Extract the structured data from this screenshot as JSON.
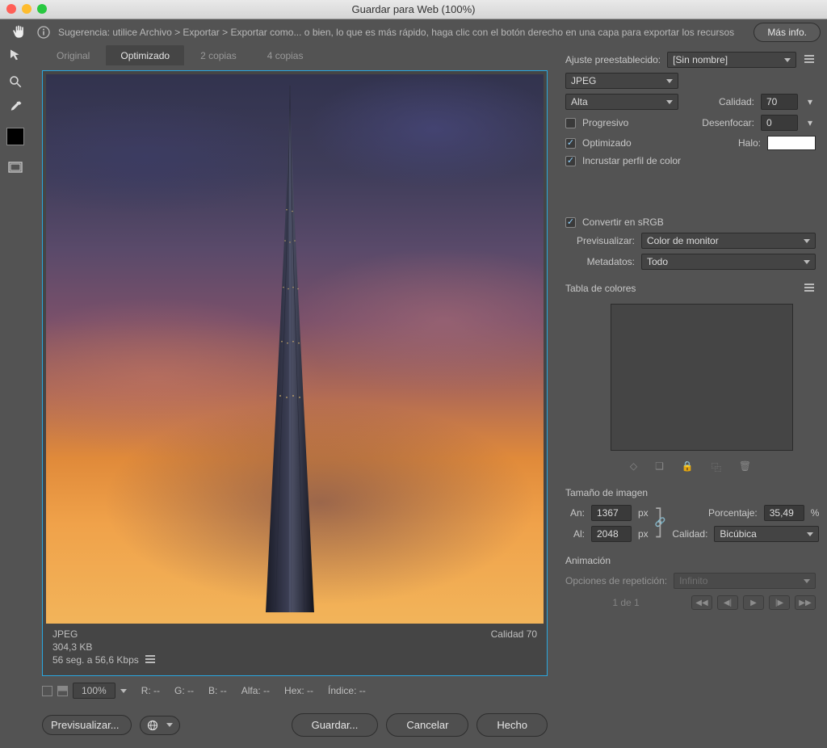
{
  "window": {
    "title": "Guardar para Web (100%)"
  },
  "hint": {
    "label": "Sugerencia: utilice Archivo > Exportar > Exportar como... o bien, lo que es más rápido, haga clic con el botón derecho en una capa para exportar los recursos",
    "more_info": "Más info."
  },
  "tabs": {
    "original": "Original",
    "optimized": "Optimizado",
    "two_up": "2 copias",
    "four_up": "4 copias"
  },
  "preview_meta": {
    "format": "JPEG",
    "size": "304,3 KB",
    "time": "56 seg. a 56,6 Kbps",
    "quality": "Calidad 70"
  },
  "status": {
    "zoom": "100%",
    "r": "R: --",
    "g": "G: --",
    "b": "B: --",
    "alpha": "Alfa: --",
    "hex": "Hex: --",
    "index": "Índice: --"
  },
  "bottom": {
    "previsualize": "Previsualizar...",
    "save": "Guardar...",
    "cancel": "Cancelar",
    "done": "Hecho"
  },
  "panel": {
    "preset_label": "Ajuste preestablecido:",
    "preset_value": "[Sin nombre]",
    "format": "JPEG",
    "quality_mode": "Alta",
    "quality_label": "Calidad:",
    "quality_value": "70",
    "progressive": "Progresivo",
    "blur_label": "Desenfocar:",
    "blur_value": "0",
    "optimized": "Optimizado",
    "halo_label": "Halo:",
    "embed_profile": "Incrustar perfil de color",
    "convert_srgb": "Convertir en sRGB",
    "preview_label": "Previsualizar:",
    "preview_value": "Color de monitor",
    "metadata_label": "Metadatos:",
    "metadata_value": "Todo",
    "colortable_title": "Tabla de colores",
    "imagesize_title": "Tamaño de imagen",
    "width_label": "An:",
    "width_value": "1367",
    "height_label": "Al:",
    "height_value": "2048",
    "px": "px",
    "percent_label": "Porcentaje:",
    "percent_value": "35,49",
    "percent_unit": "%",
    "resample_label": "Calidad:",
    "resample_value": "Bicúbica",
    "anim_title": "Animación",
    "loop_label": "Opciones de repetición:",
    "loop_value": "Infinito",
    "frame": "1 de 1"
  }
}
